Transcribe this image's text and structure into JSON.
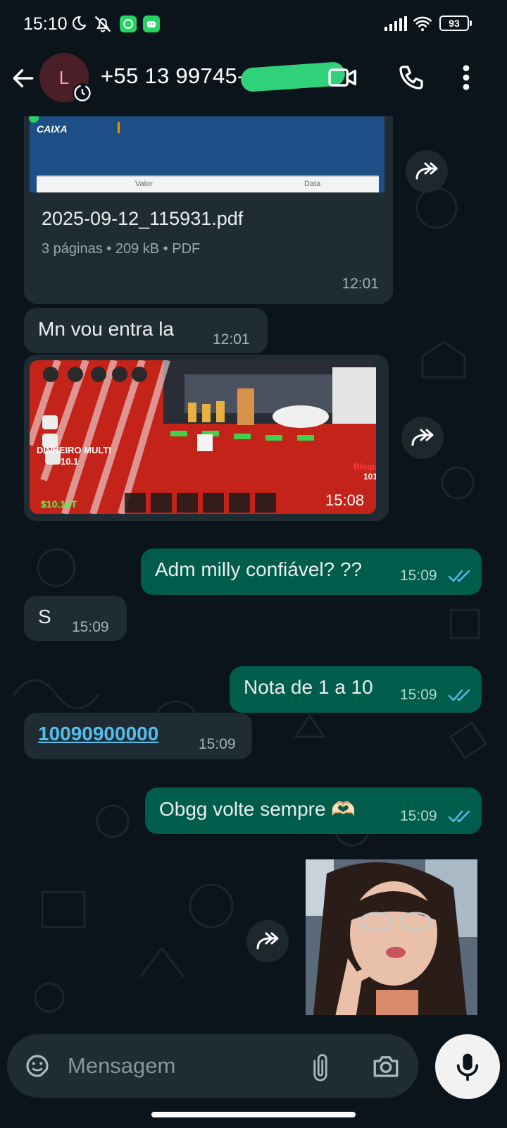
{
  "status_bar": {
    "time": "15:10",
    "battery": "93",
    "icons": [
      "moon-icon",
      "mute-icon",
      "whatsapp-icon",
      "android-icon",
      "signal-icon",
      "wifi-icon",
      "battery-icon"
    ]
  },
  "header": {
    "avatar_initial": "L",
    "contact_name": "+55 13 99745-",
    "icons": [
      "back-arrow-icon",
      "video-call-icon",
      "phone-icon",
      "more-icon"
    ]
  },
  "messages": [
    {
      "type": "document",
      "direction": "in",
      "preview_logo": "CAIXA",
      "preview_columns": [
        "Valor",
        "Data"
      ],
      "file_name": "2025-09-12_115931.pdf",
      "file_meta": "3 páginas • 209 kB • PDF",
      "time": "12:01"
    },
    {
      "type": "text",
      "direction": "in",
      "text": "Mn vou entra la",
      "time": "12:01"
    },
    {
      "type": "image",
      "direction": "in",
      "overlay_labels": [
        "DINHEIRO MULTI",
        "10.1",
        "$10.19T",
        "Bloque",
        "101"
      ],
      "time": "15:08"
    },
    {
      "type": "text",
      "direction": "out",
      "text": "Adm milly confiável? ??",
      "time": "15:09",
      "status": "read"
    },
    {
      "type": "text",
      "direction": "in",
      "text": "S",
      "time": "15:09"
    },
    {
      "type": "text",
      "direction": "out",
      "text": "Nota de 1 a 10",
      "time": "15:09",
      "status": "read"
    },
    {
      "type": "link",
      "direction": "in",
      "text": "10090900000",
      "time": "15:09"
    },
    {
      "type": "text",
      "direction": "out",
      "text": "Obgg volte sempre 🫶🏻",
      "time": "15:09",
      "status": "read"
    },
    {
      "type": "image",
      "direction": "out"
    }
  ],
  "composer": {
    "placeholder": "Mensagem",
    "icons": [
      "sticker-icon",
      "attach-icon",
      "camera-icon",
      "mic-icon"
    ]
  },
  "colors": {
    "background": "#0b141a",
    "incoming_bubble": "#202c33",
    "outgoing_bubble": "#005c4b",
    "read_ticks": "#53bdeb",
    "link": "#53bdeb"
  }
}
